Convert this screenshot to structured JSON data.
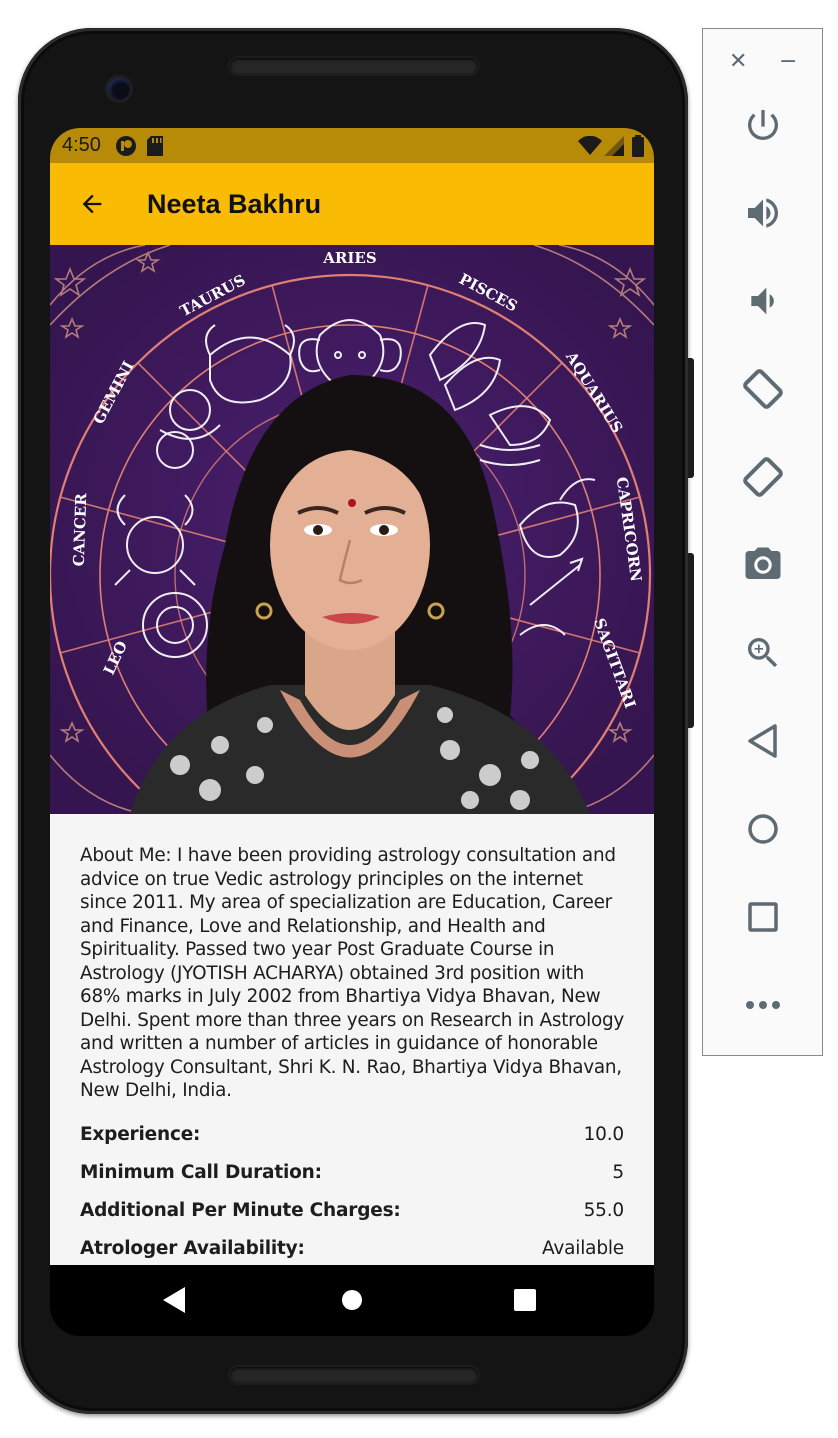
{
  "status_bar": {
    "time": "4:50",
    "icons": [
      "launcher-icon",
      "sd-card-icon",
      "wifi-icon",
      "signal-icon",
      "battery-icon"
    ]
  },
  "app_bar": {
    "title": "Neeta Bakhru",
    "back_icon": "arrow-back-icon",
    "background": "#FABB05"
  },
  "hero": {
    "zodiac_signs": [
      "ARIES",
      "PISCES",
      "AQUARIUS",
      "CAPRICORN",
      "SAGITTARI",
      "LEO",
      "CANCER",
      "GEMINI",
      "TAURUS"
    ]
  },
  "profile": {
    "about": "About Me: I have been providing astrology consultation and advice on true Vedic astrology principles on the internet since 2011. My area of specialization are Education, Career and Finance, Love and Relationship, and Health and Spirituality. Passed two year Post Graduate Course in Astrology (JYOTISH ACHARYA) obtained 3rd position with 68% marks in July 2002 from Bhartiya Vidya Bhavan, New Delhi. Spent more than three years on Research in Astrology and written a number of articles in guidance of honorable Astrology Consultant, Shri K. N. Rao, Bhartiya Vidya Bhavan, New Delhi, India.",
    "details": [
      {
        "label": "Experience:",
        "value": "10.0"
      },
      {
        "label": "Minimum Call Duration:",
        "value": "5"
      },
      {
        "label": "Additional Per Minute Charges:",
        "value": "55.0"
      },
      {
        "label": "Atrologer Availability:",
        "value": "Available"
      }
    ]
  },
  "nav_bar": {
    "buttons": [
      "back-triangle-icon",
      "home-circle-icon",
      "recents-square-icon"
    ]
  },
  "emulator_toolbar": {
    "items": [
      "close-icon",
      "minimize-icon",
      "power-icon",
      "volume-up-icon",
      "volume-down-icon",
      "rotate-left-icon",
      "rotate-right-icon",
      "camera-icon",
      "zoom-icon",
      "back-icon",
      "home-icon",
      "overview-icon",
      "more-icon"
    ]
  },
  "colors": {
    "status_bar": "#B78A07",
    "app_bar": "#FABB05",
    "hero_bg": "#3a1757",
    "content_bg": "#F5F5F5",
    "toolbar_icon": "#5f6b73"
  }
}
